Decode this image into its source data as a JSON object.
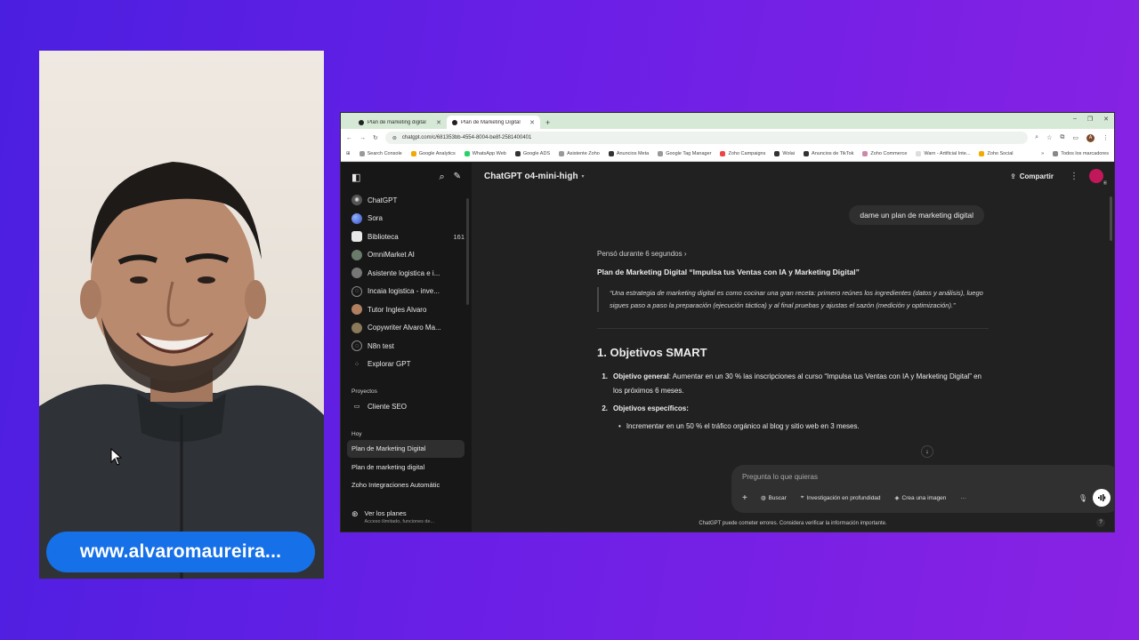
{
  "overlay": {
    "website_label": "www.alvaromaureira..."
  },
  "browser": {
    "tabs": [
      {
        "title": "Plan de marketing digital"
      },
      {
        "title": "Plan de Marketing Digital"
      }
    ],
    "url": "chatgpt.com/c/681353bb-4554-8004-be8f-2581400401"
  },
  "bookmarks": [
    "Search Console",
    "Google Analytics",
    "WhatsApp Web",
    "Google ADS",
    "Asistente Zoho",
    "Anuncios Meta",
    "Google Tag Manager",
    "Zoho Campaigns",
    "Wolai",
    "Anuncios de TikTok",
    "Zoho Commerce",
    "Warn - Artificial Inte...",
    "Zoho Social"
  ],
  "bookmarks_all": "Todos los marcadores",
  "sidebar": {
    "items": [
      {
        "label": "ChatGPT",
        "count": ""
      },
      {
        "label": "Sora",
        "count": ""
      },
      {
        "label": "Biblioteca",
        "count": "161"
      },
      {
        "label": "OmniMarket AI",
        "count": ""
      },
      {
        "label": "Asistente logistica e i...",
        "count": ""
      },
      {
        "label": "Incaia logistica - inve...",
        "count": ""
      },
      {
        "label": "Tutor Ingles Alvaro",
        "count": ""
      },
      {
        "label": "Copywriter Alvaro Ma...",
        "count": ""
      },
      {
        "label": "N8n test",
        "count": ""
      },
      {
        "label": "Explorar GPT",
        "count": ""
      }
    ],
    "projects_heading": "Proyectos",
    "projects": [
      {
        "label": "Cliente SEO"
      }
    ],
    "today_heading": "Hoy",
    "chats": [
      {
        "label": "Plan de Marketing Digital"
      },
      {
        "label": "Plan de marketing digital"
      },
      {
        "label": "Zoho Integraciones Automátic"
      }
    ],
    "plans": {
      "title": "Ver los planes",
      "subtitle": "Acceso ilimitado, funciones de..."
    }
  },
  "main": {
    "model": "ChatGPT o4-mini-high",
    "share": "Compartir",
    "user_message": "dame un plan de marketing digital",
    "thought": "Pensó durante 6 segundos",
    "answer_title": "Plan de Marketing Digital “Impulsa tus Ventas con IA y Marketing Digital”",
    "quote": "“Una estrategia de marketing digital es como cocinar una gran receta: primero reúnes los ingredientes (datos y análisis), luego sigues paso a paso la preparación (ejecución táctica) y al final pruebas y ajustas el sazón (medición y optimización).”",
    "section_title": "1. Objetivos SMART",
    "objective_general_label": "Objetivo general",
    "objective_general_text": ": Aumentar en un 30 % las inscripciones al curso “Impulsa tus Ventas con IA y Marketing Digital” en los próximos 6 meses.",
    "objective_specific_label": "Objetivos específicos:",
    "bullet_1": "Incrementar en un 50 % el tráfico orgánico al blog y sitio web en 3 meses.",
    "input_placeholder": "Pregunta lo que quieras",
    "tools": [
      "Buscar",
      "Investigación en profundidad",
      "Crea una imagen"
    ],
    "disclaimer": "ChatGPT puede cometer errores. Considera verificar la información importante."
  },
  "colors": {
    "background_gradient_start": "#4b1fe0",
    "background_gradient_end": "#8a22e3",
    "url_pill": "#1670e8",
    "chat_bg": "#212121",
    "sidebar_bg": "#171717"
  }
}
